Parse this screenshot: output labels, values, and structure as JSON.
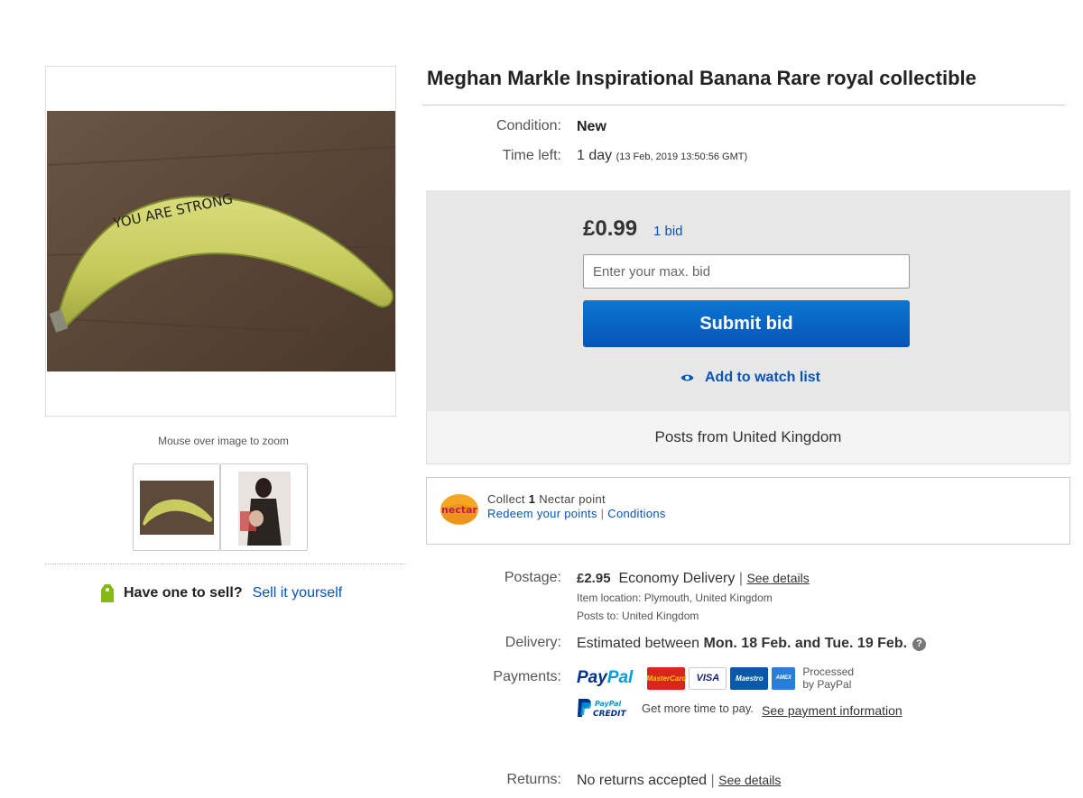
{
  "gallery": {
    "zoom_hint": "Mouse over image to zoom",
    "main_image_caption": "YOU ARE STRONG"
  },
  "sell": {
    "question": "Have one to sell?",
    "link": "Sell it yourself"
  },
  "listing": {
    "title": "Meghan Markle Inspirational Banana Rare royal collectible",
    "condition_label": "Condition:",
    "condition_value": "New",
    "time_left_label": "Time left:",
    "time_left_value": "1 day",
    "time_left_detail": "(13 Feb, 2019   13:50:56 GMT)"
  },
  "bid": {
    "price": "£0.99",
    "bid_count": "1 bid",
    "input_placeholder": "Enter your max. bid",
    "submit_label": "Submit bid",
    "watch_label": "Add to watch list",
    "posts_from": "Posts from United Kingdom"
  },
  "nectar": {
    "logo_text": "nectar",
    "collect_prefix": "Collect",
    "points": "1",
    "collect_suffix": "Nectar point",
    "redeem_link": "Redeem your points",
    "separator": "|",
    "conditions_link": "Conditions"
  },
  "postage": {
    "label": "Postage:",
    "price": "£2.95",
    "service": "Economy Delivery",
    "separator": "|",
    "details_link": "See details",
    "item_location": "Item location:  Plymouth, United Kingdom",
    "posts_to": "Posts to:  United Kingdom"
  },
  "delivery": {
    "label": "Delivery:",
    "prefix": "Estimated between",
    "dates": "Mon. 18 Feb. and Tue. 19 Feb.",
    "help_icon": "?"
  },
  "payments": {
    "label": "Payments:",
    "paypal_a": "Pay",
    "paypal_b": "Pal",
    "cards": [
      "MasterCard",
      "VISA",
      "Maestro",
      "AMEX"
    ],
    "processed_line1": "Processed",
    "processed_line2": "by PayPal",
    "credit_logo_line1": "PayPal",
    "credit_logo_line2": "CREDIT",
    "credit_text": "Get more time to pay.",
    "payment_info_link": "See payment information"
  },
  "returns": {
    "label": "Returns:",
    "value": "No returns accepted",
    "separator": "|",
    "details_link": "See details"
  },
  "colors": {
    "link_blue": "#0654ba",
    "submit_blue": "#0654ba",
    "bid_box_bg": "#e7e7e7",
    "nectar_orange": "#f5a623"
  }
}
